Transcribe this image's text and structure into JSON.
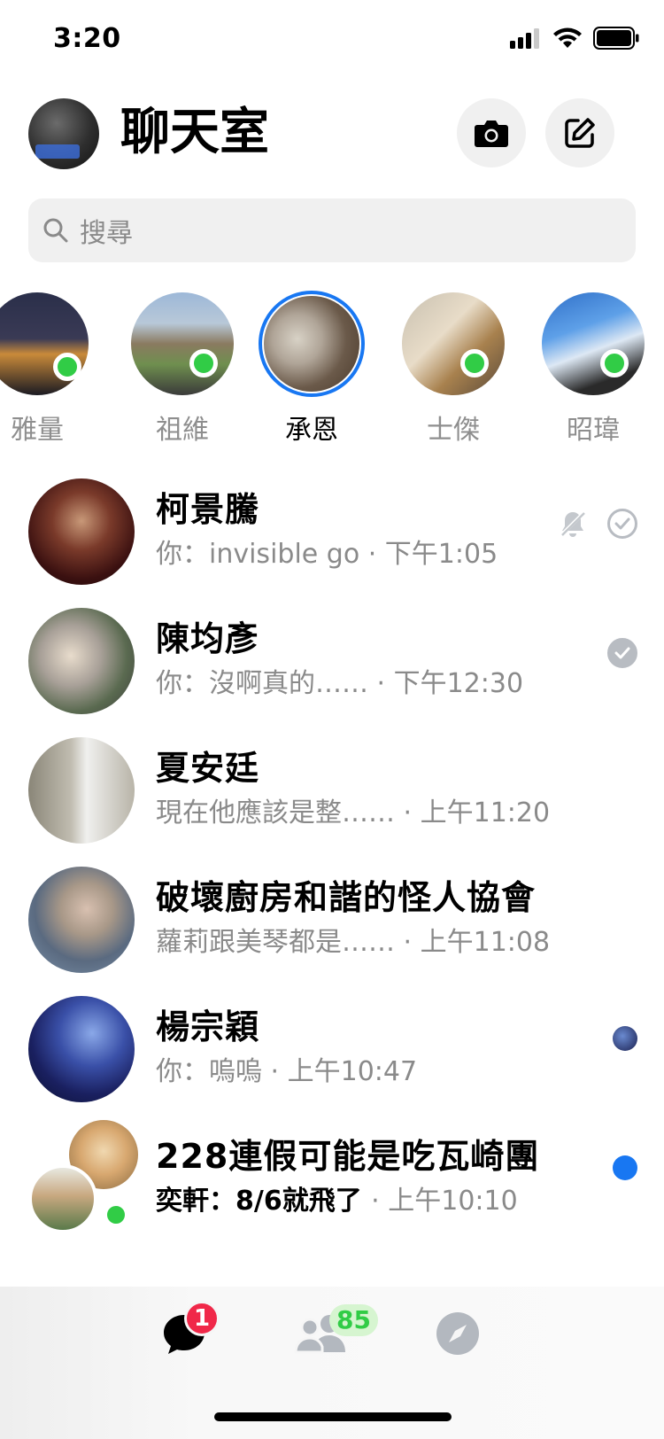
{
  "status_bar": {
    "time": "3:20"
  },
  "header": {
    "title": "聊天室"
  },
  "search": {
    "placeholder": "搜尋"
  },
  "stories": [
    {
      "name": "雅量",
      "online": true,
      "active": false
    },
    {
      "name": "祖維",
      "online": true,
      "active": false
    },
    {
      "name": "承恩",
      "online": false,
      "active": true
    },
    {
      "name": "士傑",
      "online": true,
      "active": false
    },
    {
      "name": "昭瑋",
      "online": true,
      "active": false
    }
  ],
  "chats": [
    {
      "name": "柯景騰",
      "preview": "你：invisible go",
      "time": "· 下午1:05",
      "muted": true,
      "status": "sent",
      "unread": false
    },
    {
      "name": "陳均彥",
      "preview": "你：沒啊真的……",
      "time": "· 下午12:30",
      "muted": false,
      "status": "delivered",
      "unread": false
    },
    {
      "name": "夏安廷",
      "preview": "現在他應該是整……",
      "time": "· 上午11:20",
      "muted": false,
      "status": "none",
      "unread": false
    },
    {
      "name": "破壞廚房和諧的怪人協會",
      "preview": "蘿莉跟美琴都是……",
      "time": "· 上午11:08",
      "muted": false,
      "status": "none",
      "unread": false
    },
    {
      "name": "楊宗穎",
      "preview": "你：嗚嗚",
      "time": "· 上午10:47",
      "muted": false,
      "status": "seen",
      "unread": false
    },
    {
      "name": "228連假可能是吃瓦崎團",
      "preview": "奕軒：8/6就飛了",
      "time": "· 上午10:10",
      "muted": false,
      "status": "unread",
      "unread": true
    }
  ],
  "tab_bar": {
    "chats_badge": "1",
    "people_badge": "85"
  },
  "colors": {
    "accent": "#1877f2",
    "online": "#31cc46",
    "badge": "#f02849"
  }
}
